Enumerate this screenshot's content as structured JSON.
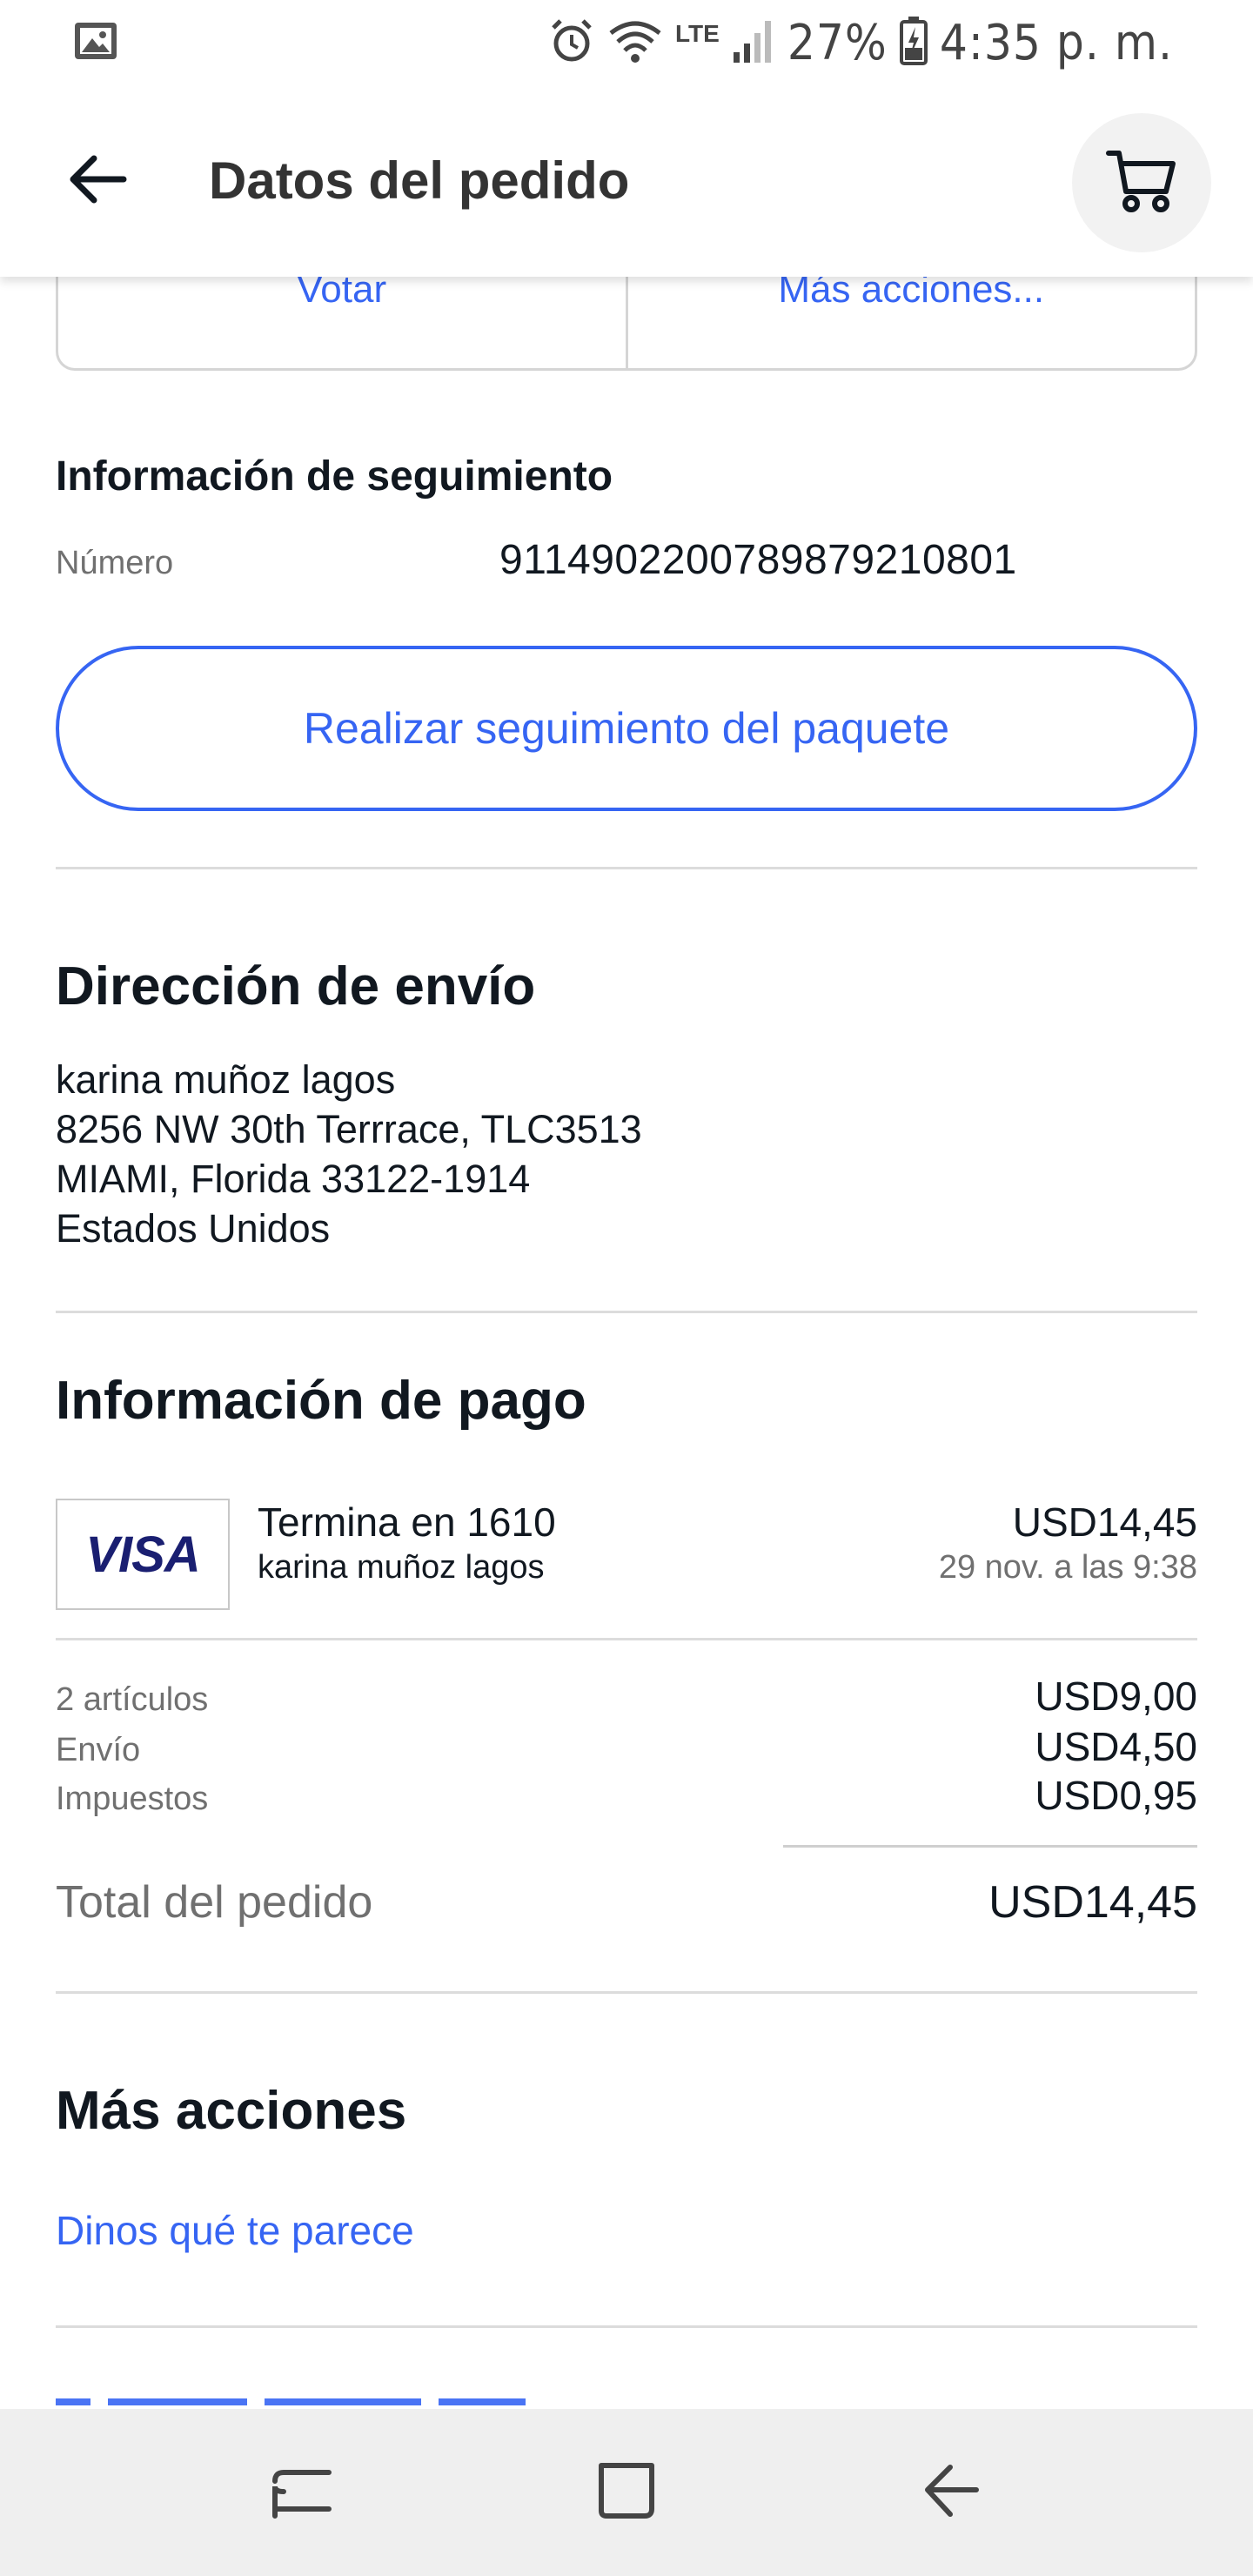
{
  "status_bar": {
    "battery": "27%",
    "time": "4:35 p. m.",
    "network": "LTE",
    "icons": [
      "gallery-icon",
      "alarm-icon",
      "wifi-icon",
      "signal-icon",
      "battery-icon"
    ]
  },
  "app_bar": {
    "title": "Datos del pedido",
    "back_icon": "arrow-left-icon",
    "cart_icon": "shopping-cart-icon"
  },
  "actions_row": {
    "vote": "Votar",
    "more": "Más acciones..."
  },
  "tracking": {
    "title": "Información de seguimiento",
    "number_label": "Número",
    "number_value": "9114902200789879210801",
    "track_button": "Realizar seguimiento del paquete"
  },
  "shipping": {
    "title": "Dirección de envío",
    "lines": [
      "karina muñoz lagos",
      "8256 NW 30th Terrrace, TLC3513",
      "MIAMI, Florida 33122-1914",
      "Estados Unidos"
    ]
  },
  "payment": {
    "title": "Información de pago",
    "card_brand": "VISA",
    "card_ending": "Termina en 1610",
    "card_holder": "karina muñoz lagos",
    "amount": "USD14,45",
    "date": "29 nov. a las 9:38",
    "summary": [
      {
        "label": "2 artículos",
        "value": "USD9,00"
      },
      {
        "label": "Envío",
        "value": "USD4,50"
      },
      {
        "label": "Impuestos",
        "value": "USD0,95"
      }
    ],
    "total_label": "Total del pedido",
    "total_value": "USD14,45"
  },
  "more_actions": {
    "title": "Más acciones",
    "feedback_link": "Dinos qué te parece"
  },
  "colors": {
    "accent": "#3665f3",
    "text": "#111820",
    "muted": "#707070",
    "divider": "#dcdcdc",
    "visa": "#1a1f71",
    "nav_bg": "#efefef"
  },
  "nav_bar": {
    "icons": [
      "recent-apps-icon",
      "home-icon",
      "back-icon"
    ]
  }
}
